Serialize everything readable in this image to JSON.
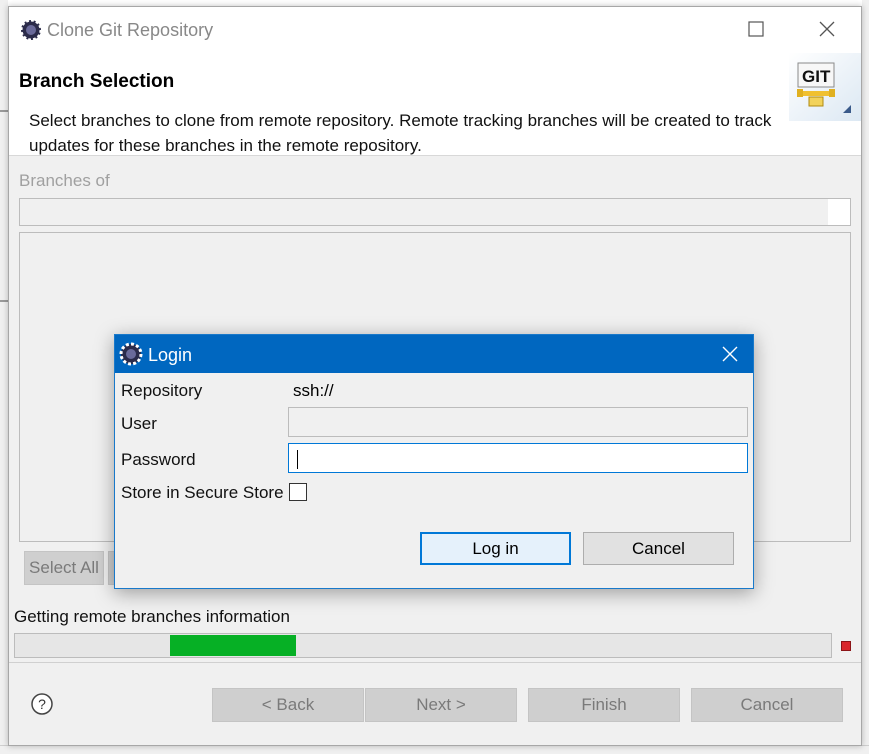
{
  "window": {
    "title": "Clone Git Repository",
    "minimize_icon": "minimize-icon",
    "maximize_icon": "maximize-icon",
    "close_icon": "close-icon"
  },
  "header": {
    "title": "Branch Selection",
    "description": "Select branches to clone from remote repository. Remote tracking branches will be created to track updates for these branches in the remote repository.",
    "logo_text": "GIT"
  },
  "branches": {
    "label": "Branches of",
    "value": ""
  },
  "list_buttons": {
    "select_all": "Select All"
  },
  "progress": {
    "label": "Getting remote branches information",
    "fill_start_fraction": 0.19,
    "fill_end_fraction": 0.345,
    "color": "#06b025"
  },
  "footer": {
    "help_icon": "help-icon",
    "back": "< Back",
    "next": "Next >",
    "finish": "Finish",
    "cancel": "Cancel"
  },
  "login": {
    "title": "Login",
    "repository_label": "Repository",
    "repository_value": "ssh://",
    "user_label": "User",
    "user_value": "",
    "password_label": "Password",
    "password_value": "",
    "store_label": "Store in Secure Store",
    "store_checked": false,
    "login_button": "Log in",
    "cancel_button": "Cancel",
    "accent": "#0067c0"
  }
}
